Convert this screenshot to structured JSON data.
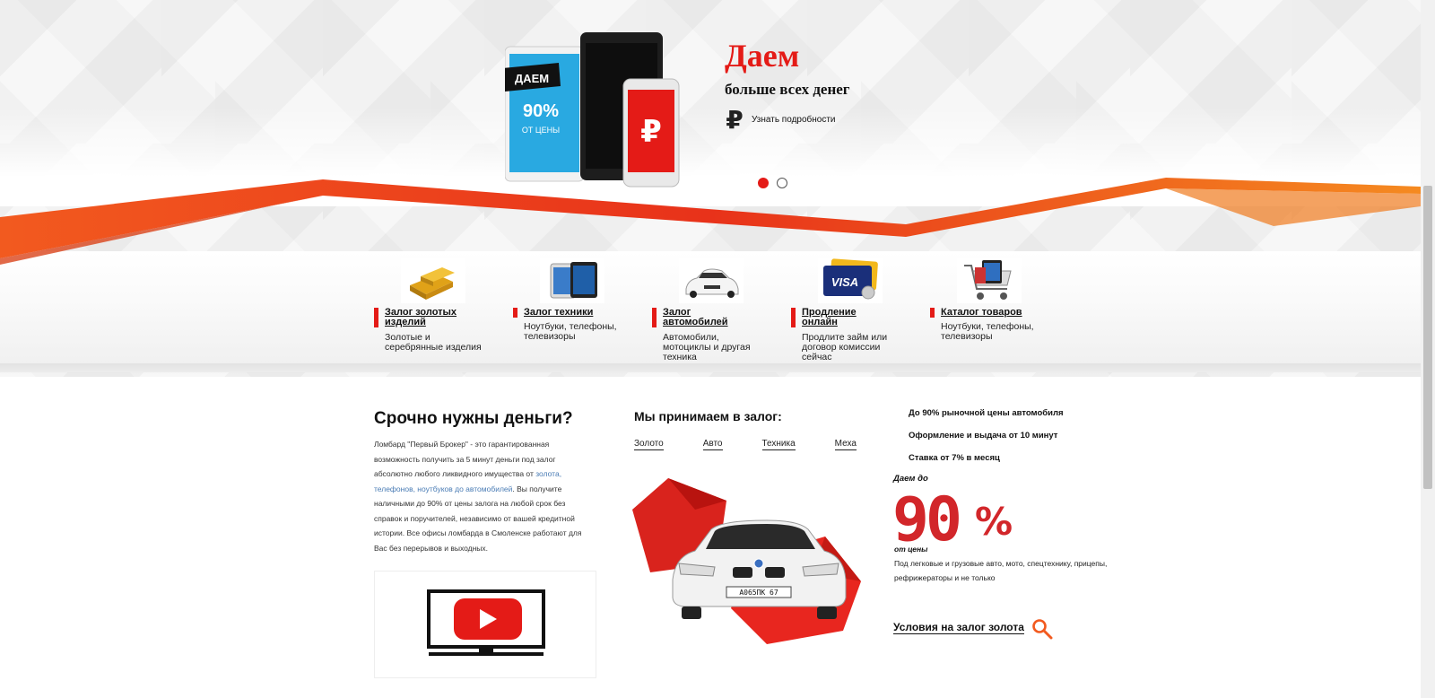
{
  "slider": {
    "device_badge": "ДАЕМ",
    "device_pct": "90%",
    "device_sub": "ОТ ЦЕНЫ",
    "title": "Даем",
    "subtitle": "больше всех денег",
    "link_icon": "ruble-icon",
    "link_text": "Узнать подробности",
    "dots_count": 2,
    "active_dot": 1
  },
  "categories": [
    {
      "icon": "gold-bars-icon",
      "title_line1": "Залог золотых",
      "title_line2": "изделий",
      "desc_line1": "Золотые и",
      "desc_line2": "серебрянные изделия",
      "desc_line3": ""
    },
    {
      "icon": "tablet-icon",
      "title_line1": "Залог техники",
      "title_line2": "",
      "desc_line1": "Ноутбуки, телефоны,",
      "desc_line2": "телевизоры",
      "desc_line3": ""
    },
    {
      "icon": "car-icon",
      "title_line1": "Залог",
      "title_line2": "автомобилей",
      "desc_line1": "Автомобили,",
      "desc_line2": "мотоциклы и другая",
      "desc_line3": "техника"
    },
    {
      "icon": "visa-card-icon",
      "title_line1": "Продление",
      "title_line2": "онлайн",
      "desc_line1": "Продлите займ или",
      "desc_line2": "договор комиссии",
      "desc_line3": "сейчас"
    },
    {
      "icon": "shopping-cart-icon",
      "title_line1": "Каталог товаров",
      "title_line2": "",
      "desc_line1": "Ноутбуки, телефоны,",
      "desc_line2": "телевизоры",
      "desc_line3": ""
    }
  ],
  "urgent": {
    "heading": "Срочно нужны деньги?",
    "p1": "Ломбард \"Первый Брокер\" - это гарантированная возможность получить за 5 минут деньги под залог абсолютно любого ликвидного имущества от ",
    "link1": "золота,",
    "space": " ",
    "link2": "телефонов, ноутбуков до автомобилей",
    "p2": ". Вы получите наличными до 90% от цены залога на любой срок без справок и поручителей, независимо от вашей кредитной истории. Все офисы ломбарда в Смоленске работают для Вас без перерывов и выходных.",
    "video_icon": "youtube-play-icon"
  },
  "accept": {
    "heading": "Мы принимаем в залог:",
    "tabs": [
      "Золото",
      "Авто",
      "Техника",
      "Меха"
    ],
    "plate": "А065ПК 67"
  },
  "benefits": {
    "items": [
      "До 90% рыночной цены автомобиля",
      "Оформление и выдача от 10 минут",
      "Ставка от 7% в месяц"
    ],
    "give_up_to": "Даем до",
    "big_value": "90",
    "big_sign": "%",
    "of_price": "от цены",
    "desc": "Под легковые и грузовые авто, мото, спецтехнику, прицепы, рефрижераторы и не только",
    "gold_link": "Условия на залог золота"
  },
  "colors": {
    "accent": "#e41b17",
    "wave_orange": "#f25a1f",
    "link_blue": "#4a7cb5"
  }
}
